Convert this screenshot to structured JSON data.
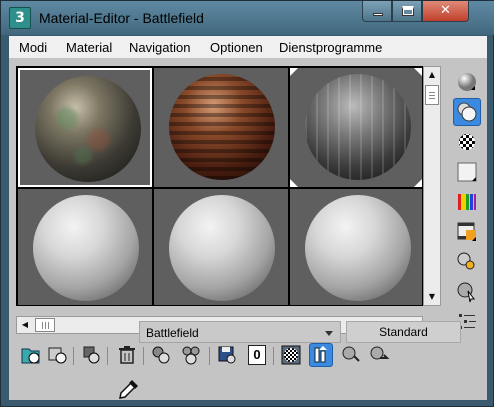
{
  "window": {
    "title": "Material-Editor - Battlefield",
    "app_icon_text": "3",
    "close_glyph": "✕"
  },
  "menu": {
    "items": [
      "Modi",
      "Material",
      "Navigation",
      "Optionen",
      "Dienstprogramme"
    ]
  },
  "slots": [
    {
      "name": "weathered-mottled-material",
      "active": true
    },
    {
      "name": "rusted-metal-material",
      "active": false
    },
    {
      "name": "weathered-wood-planks-material",
      "active": false
    },
    {
      "name": "default-gray-material",
      "active": false
    },
    {
      "name": "default-gray-material",
      "active": false
    },
    {
      "name": "default-gray-material",
      "active": false
    }
  ],
  "side_toolbar": [
    "sample-type-sphere-icon",
    "backlight-icon",
    "background-checker-icon",
    "sample-uv-tiling-icon",
    "video-color-check-icon",
    "make-preview-icon",
    "material-editor-options-icon",
    "select-by-material-icon",
    "material-map-navigator-icon"
  ],
  "bottom_toolbar": [
    "get-material-icon",
    "assign-material-to-selection-icon",
    "put-to-scene-icon",
    "reset-map-icon",
    "make-material-copy-icon",
    "make-unique-icon",
    "put-to-library-icon",
    "material-id-channel-icon",
    "show-map-in-viewport-icon",
    "show-end-result-icon",
    "go-to-parent-icon",
    "go-forward-to-sibling-icon"
  ],
  "material_id_channel": "0",
  "material_name": "Battlefield",
  "material_type": "Standard",
  "colors": {
    "title_bar": "#4a7189",
    "accent_active_tool": "#3b8ae0",
    "slot_background": "#5f5f5f"
  }
}
